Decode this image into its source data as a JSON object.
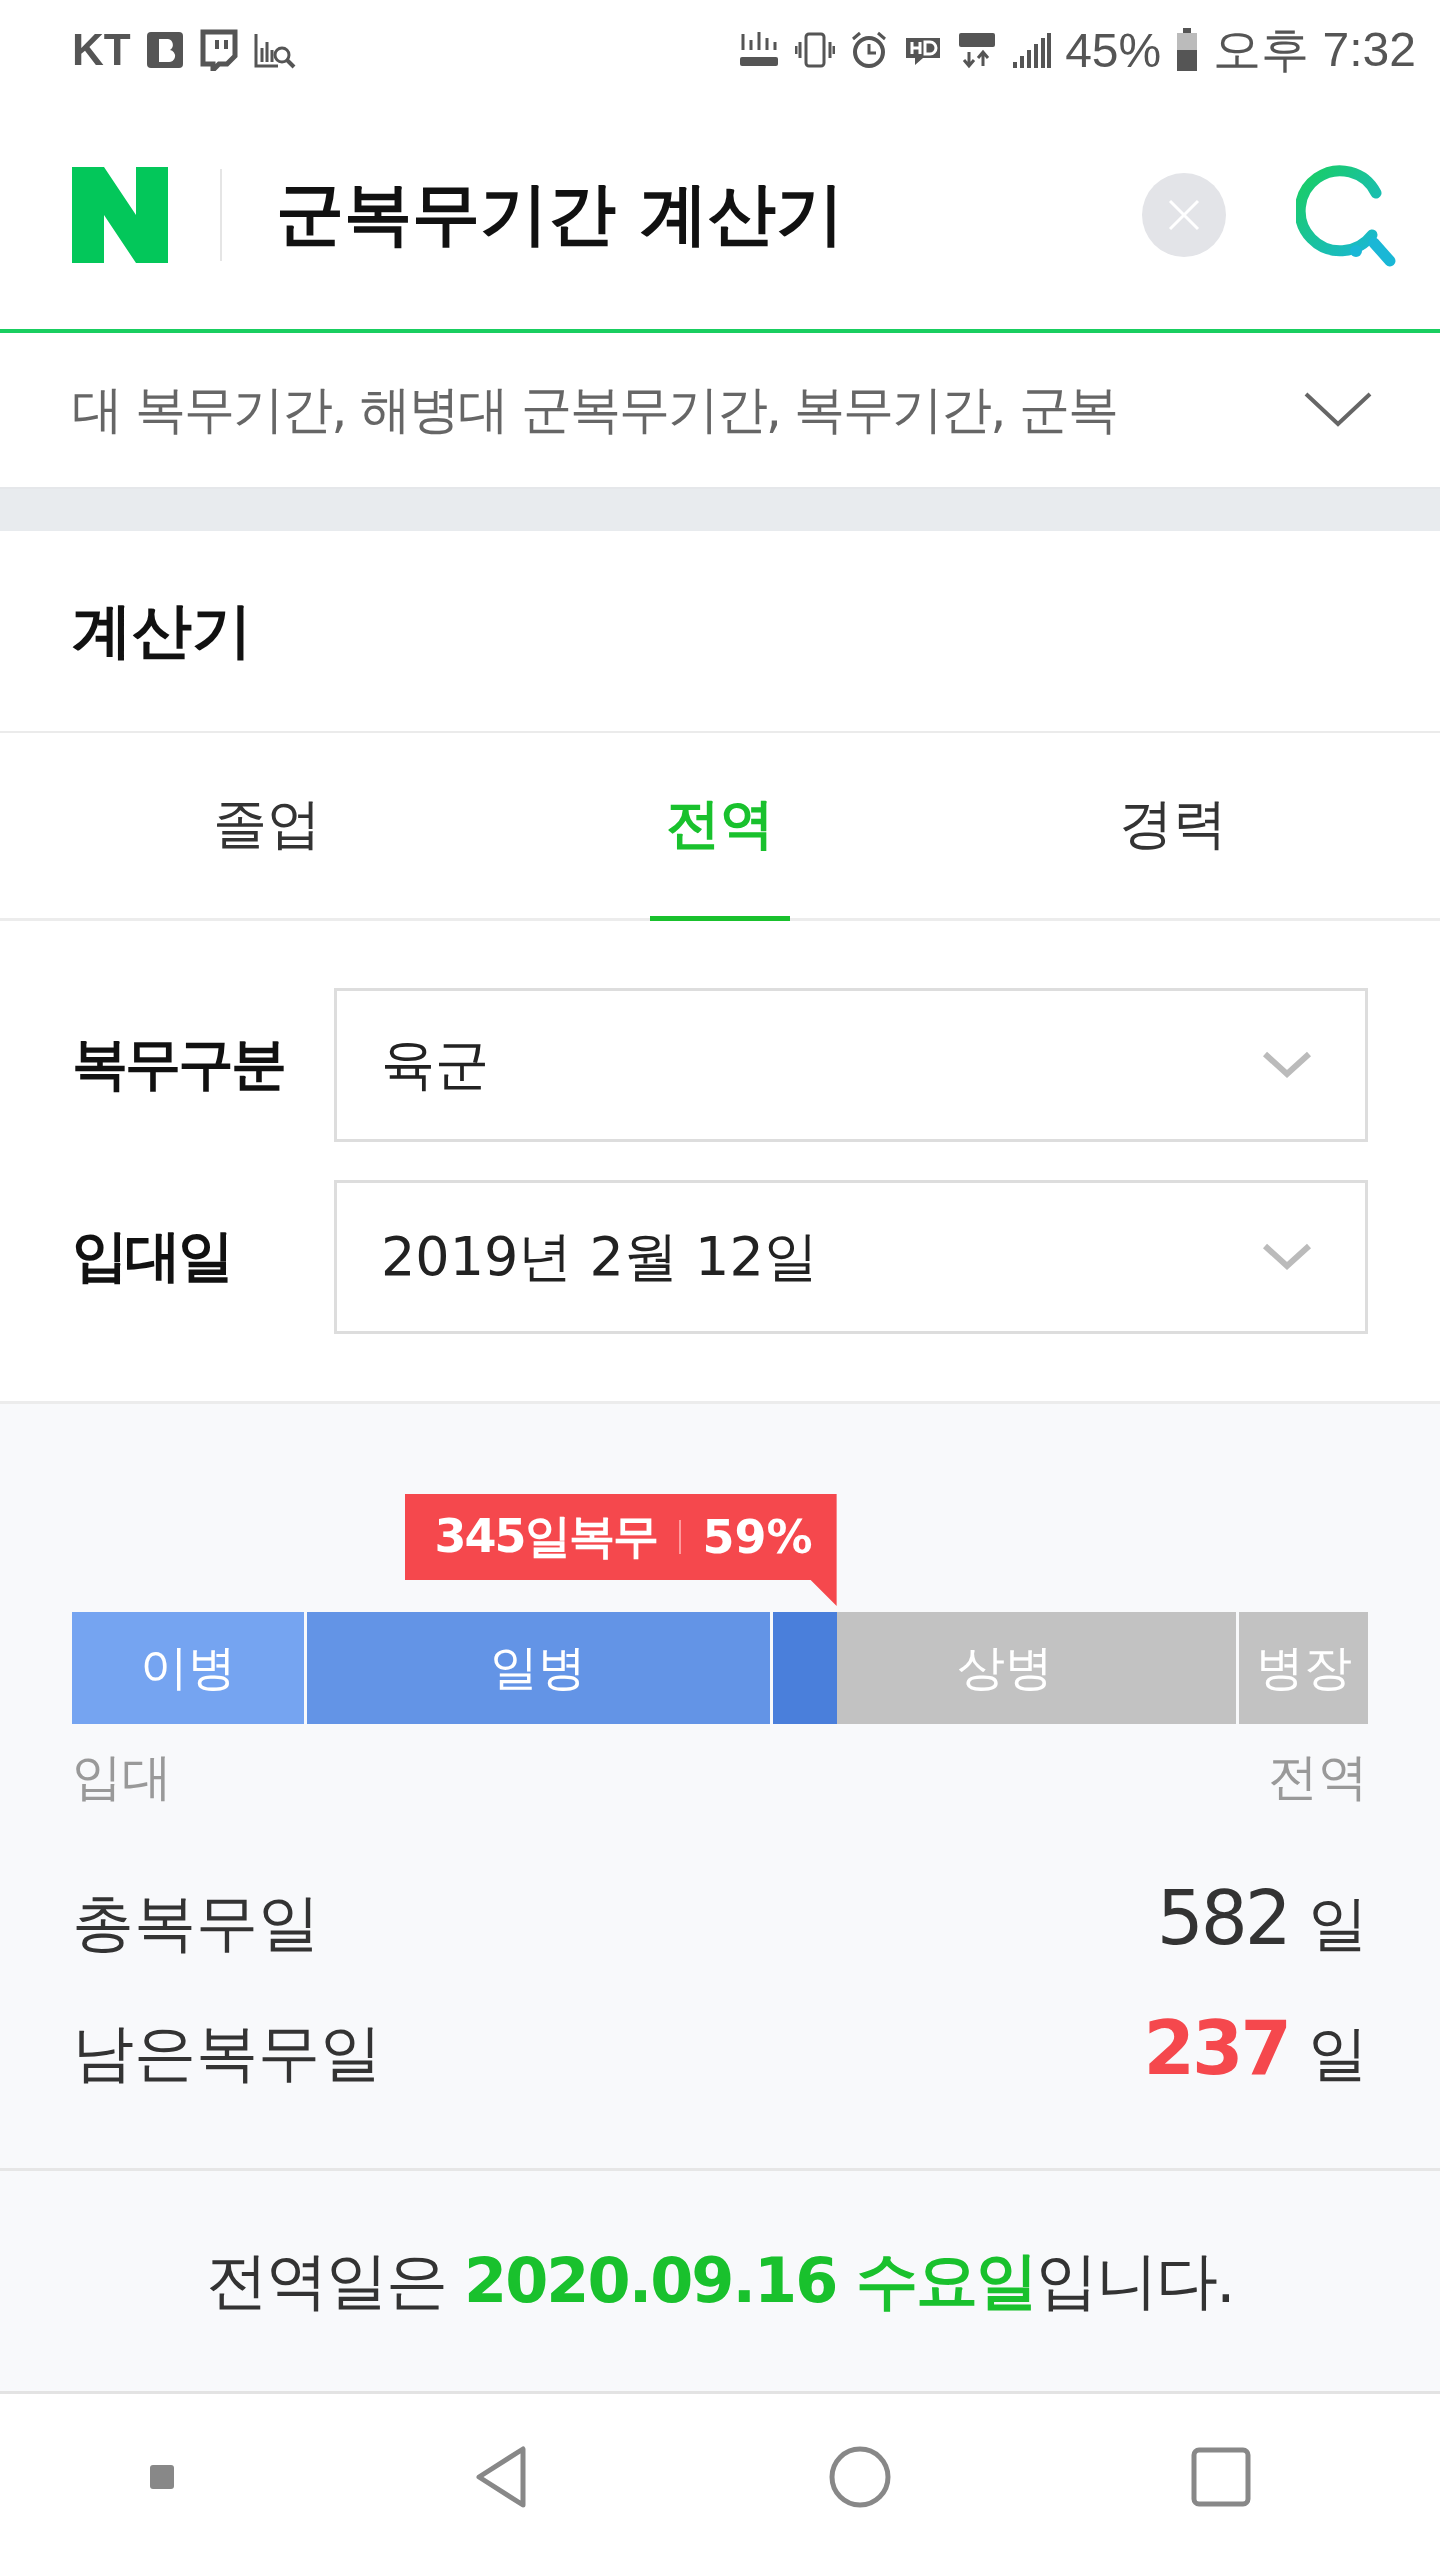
{
  "status_bar": {
    "carrier": "KT",
    "battery": "45%",
    "time": "오후 7:32"
  },
  "search": {
    "query": "군복무기간 계산기"
  },
  "keywords": {
    "text": "대 복무기간, 해병대 군복무기간, 복무기간, 군복"
  },
  "section": {
    "title": "계산기"
  },
  "tabs": [
    {
      "label": "졸업",
      "selected": false
    },
    {
      "label": "전역",
      "selected": true
    },
    {
      "label": "경력",
      "selected": false
    }
  ],
  "form": [
    {
      "label": "복무구분",
      "value": "육군"
    },
    {
      "label": "입대일",
      "value": "2019년 2월 12일"
    }
  ],
  "progress": {
    "days": "345일복무",
    "percent": "59%",
    "level": 0.59,
    "segments": [
      {
        "label": "이병",
        "color": "#75a4f1"
      },
      {
        "label": "일병",
        "color": "#6394e6"
      },
      {
        "label": "상병",
        "color": "#4a7fdb"
      },
      {
        "label": "병장"
      }
    ],
    "start_label": "입대",
    "end_label": "전역"
  },
  "stats": [
    {
      "label": "총복무일",
      "value": "582",
      "unit": "일",
      "highlight": false
    },
    {
      "label": "남은복무일",
      "value": "237",
      "unit": "일",
      "highlight": true
    }
  ],
  "result": "전역일은 **2020.09.16 수요일**입니다."
}
